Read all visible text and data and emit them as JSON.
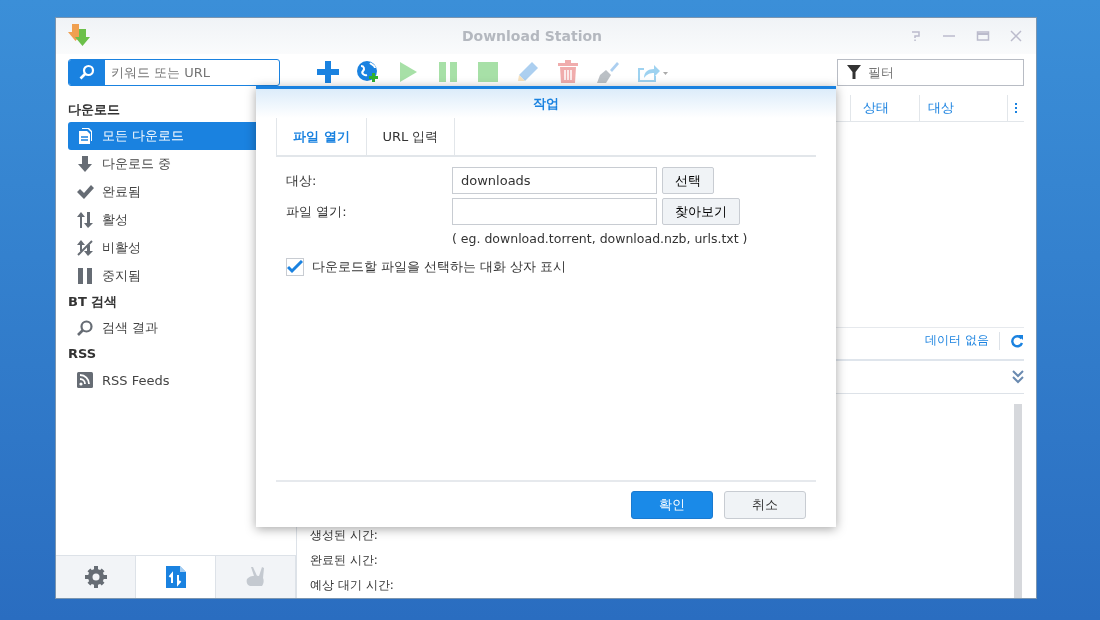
{
  "window": {
    "title": "Download Station"
  },
  "search": {
    "placeholder": "키워드 또는 URL"
  },
  "toolbar": [
    {
      "kind": "add",
      "disabled": false
    },
    {
      "kind": "globe",
      "disabled": false
    },
    {
      "kind": "play",
      "disabled": true
    },
    {
      "kind": "pause",
      "disabled": true
    },
    {
      "kind": "stop",
      "disabled": true
    },
    {
      "kind": "edit",
      "disabled": true
    },
    {
      "kind": "delete",
      "disabled": true
    },
    {
      "kind": "clean",
      "disabled": true
    },
    {
      "kind": "share",
      "disabled": true
    }
  ],
  "filter": {
    "placeholder": "필터"
  },
  "sidebar": {
    "sections": [
      {
        "title": "다운로드",
        "items": [
          {
            "label": "모든 다운로드",
            "kind": "doc",
            "selected": true
          },
          {
            "label": "다운로드 중",
            "kind": "down",
            "selected": false
          },
          {
            "label": "완료됨",
            "kind": "check",
            "selected": false
          },
          {
            "label": "활성",
            "kind": "updown",
            "selected": false
          },
          {
            "label": "비활성",
            "kind": "inactive",
            "selected": false
          },
          {
            "label": "중지됨",
            "kind": "pause",
            "selected": false
          }
        ]
      },
      {
        "title": "BT 검색",
        "items": [
          {
            "label": "검색 결과",
            "kind": "search",
            "selected": false
          }
        ]
      },
      {
        "title": "RSS",
        "items": [
          {
            "label": "RSS Feeds",
            "kind": "rss",
            "selected": false
          }
        ]
      }
    ],
    "footer": [
      {
        "kind": "settings",
        "selected": false
      },
      {
        "kind": "transfer",
        "selected": true
      },
      {
        "kind": "emule",
        "selected": false
      }
    ]
  },
  "table": {
    "columns": [
      "상태",
      "대상"
    ]
  },
  "status": {
    "text": "데이터 없음"
  },
  "details": {
    "fields": [
      "생성된 시간:",
      "완료된 시간:",
      "예상 대기 시간:"
    ]
  },
  "dialog": {
    "title": "작업",
    "tabs": [
      {
        "label": "파일 열기",
        "selected": true
      },
      {
        "label": "URL 입력",
        "selected": false
      }
    ],
    "fields": [
      {
        "label": "대상:",
        "value": "downloads",
        "button": "선택"
      },
      {
        "label": "파일 열기:",
        "button": "찾아보기"
      }
    ],
    "hint": "( eg. download.torrent, download.nzb, urls.txt )",
    "checkbox": {
      "label": "다운로드할 파일을 선택하는 대화 상자 표시",
      "checked": true
    },
    "buttons": [
      {
        "label": "확인",
        "kind": "primary"
      },
      {
        "label": "취소",
        "kind": "secondary"
      }
    ]
  }
}
